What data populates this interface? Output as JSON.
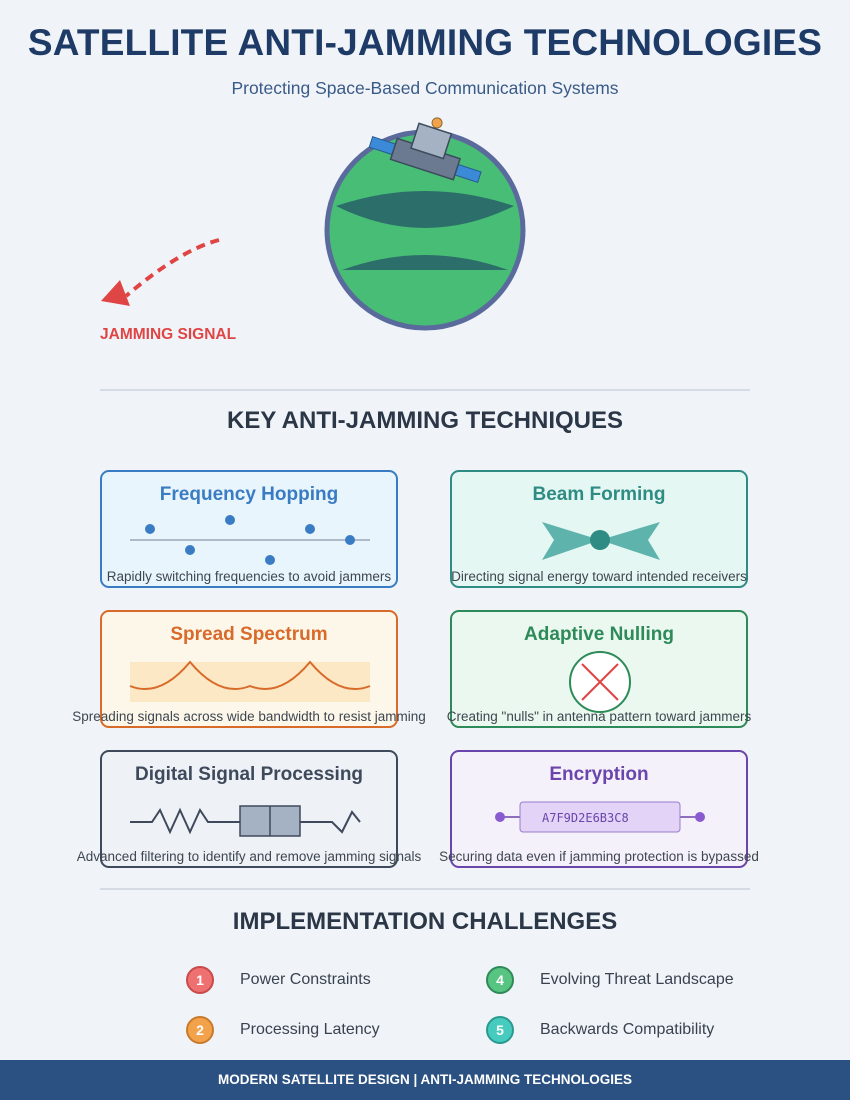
{
  "header": {
    "title": "SATELLITE ANTI-JAMMING TECHNOLOGIES",
    "subtitle": "Protecting Space-Based Communication Systems"
  },
  "hero": {
    "jamming_label": "JAMMING SIGNAL"
  },
  "techniques": {
    "heading": "KEY ANTI-JAMMING TECHNIQUES",
    "items": [
      {
        "title": "Frequency Hopping",
        "desc": "Rapidly switching frequencies to avoid jammers",
        "color": "#3a7cc3",
        "bg": "#e9f5fd"
      },
      {
        "title": "Beam Forming",
        "desc": "Directing signal energy toward intended receivers",
        "color": "#2f8c85",
        "bg": "#e5f7f3"
      },
      {
        "title": "Spread Spectrum",
        "desc": "Spreading signals across wide bandwidth to resist jamming",
        "color": "#d86a2a",
        "bg": "#fdf7ea"
      },
      {
        "title": "Adaptive Nulling",
        "desc": "Creating \"nulls\" in antenna pattern toward jammers",
        "color": "#2e8a58",
        "bg": "#eaf8ef"
      },
      {
        "title": "Digital Signal Processing",
        "desc": "Advanced filtering to identify and remove jamming signals",
        "color": "#3e4a5c",
        "bg": "#eef1f5"
      },
      {
        "title": "Encryption",
        "desc": "Securing data even if jamming protection is bypassed",
        "color": "#6a45ab",
        "bg": "#f5f1fb",
        "code": "A7F9D2E6B3C8"
      }
    ]
  },
  "challenges": {
    "heading": "IMPLEMENTATION CHALLENGES",
    "items": [
      {
        "num": "1",
        "label": "Power Constraints",
        "color": "#ef7070"
      },
      {
        "num": "2",
        "label": "Processing Latency",
        "color": "#f3a24c"
      },
      {
        "num": "4",
        "label": "Evolving Threat Landscape",
        "color": "#58c481"
      },
      {
        "num": "5",
        "label": "Backwards Compatibility",
        "color": "#48cbbf"
      }
    ]
  },
  "footer": {
    "text": "MODERN SATELLITE DESIGN | ANTI-JAMMING TECHNOLOGIES"
  }
}
